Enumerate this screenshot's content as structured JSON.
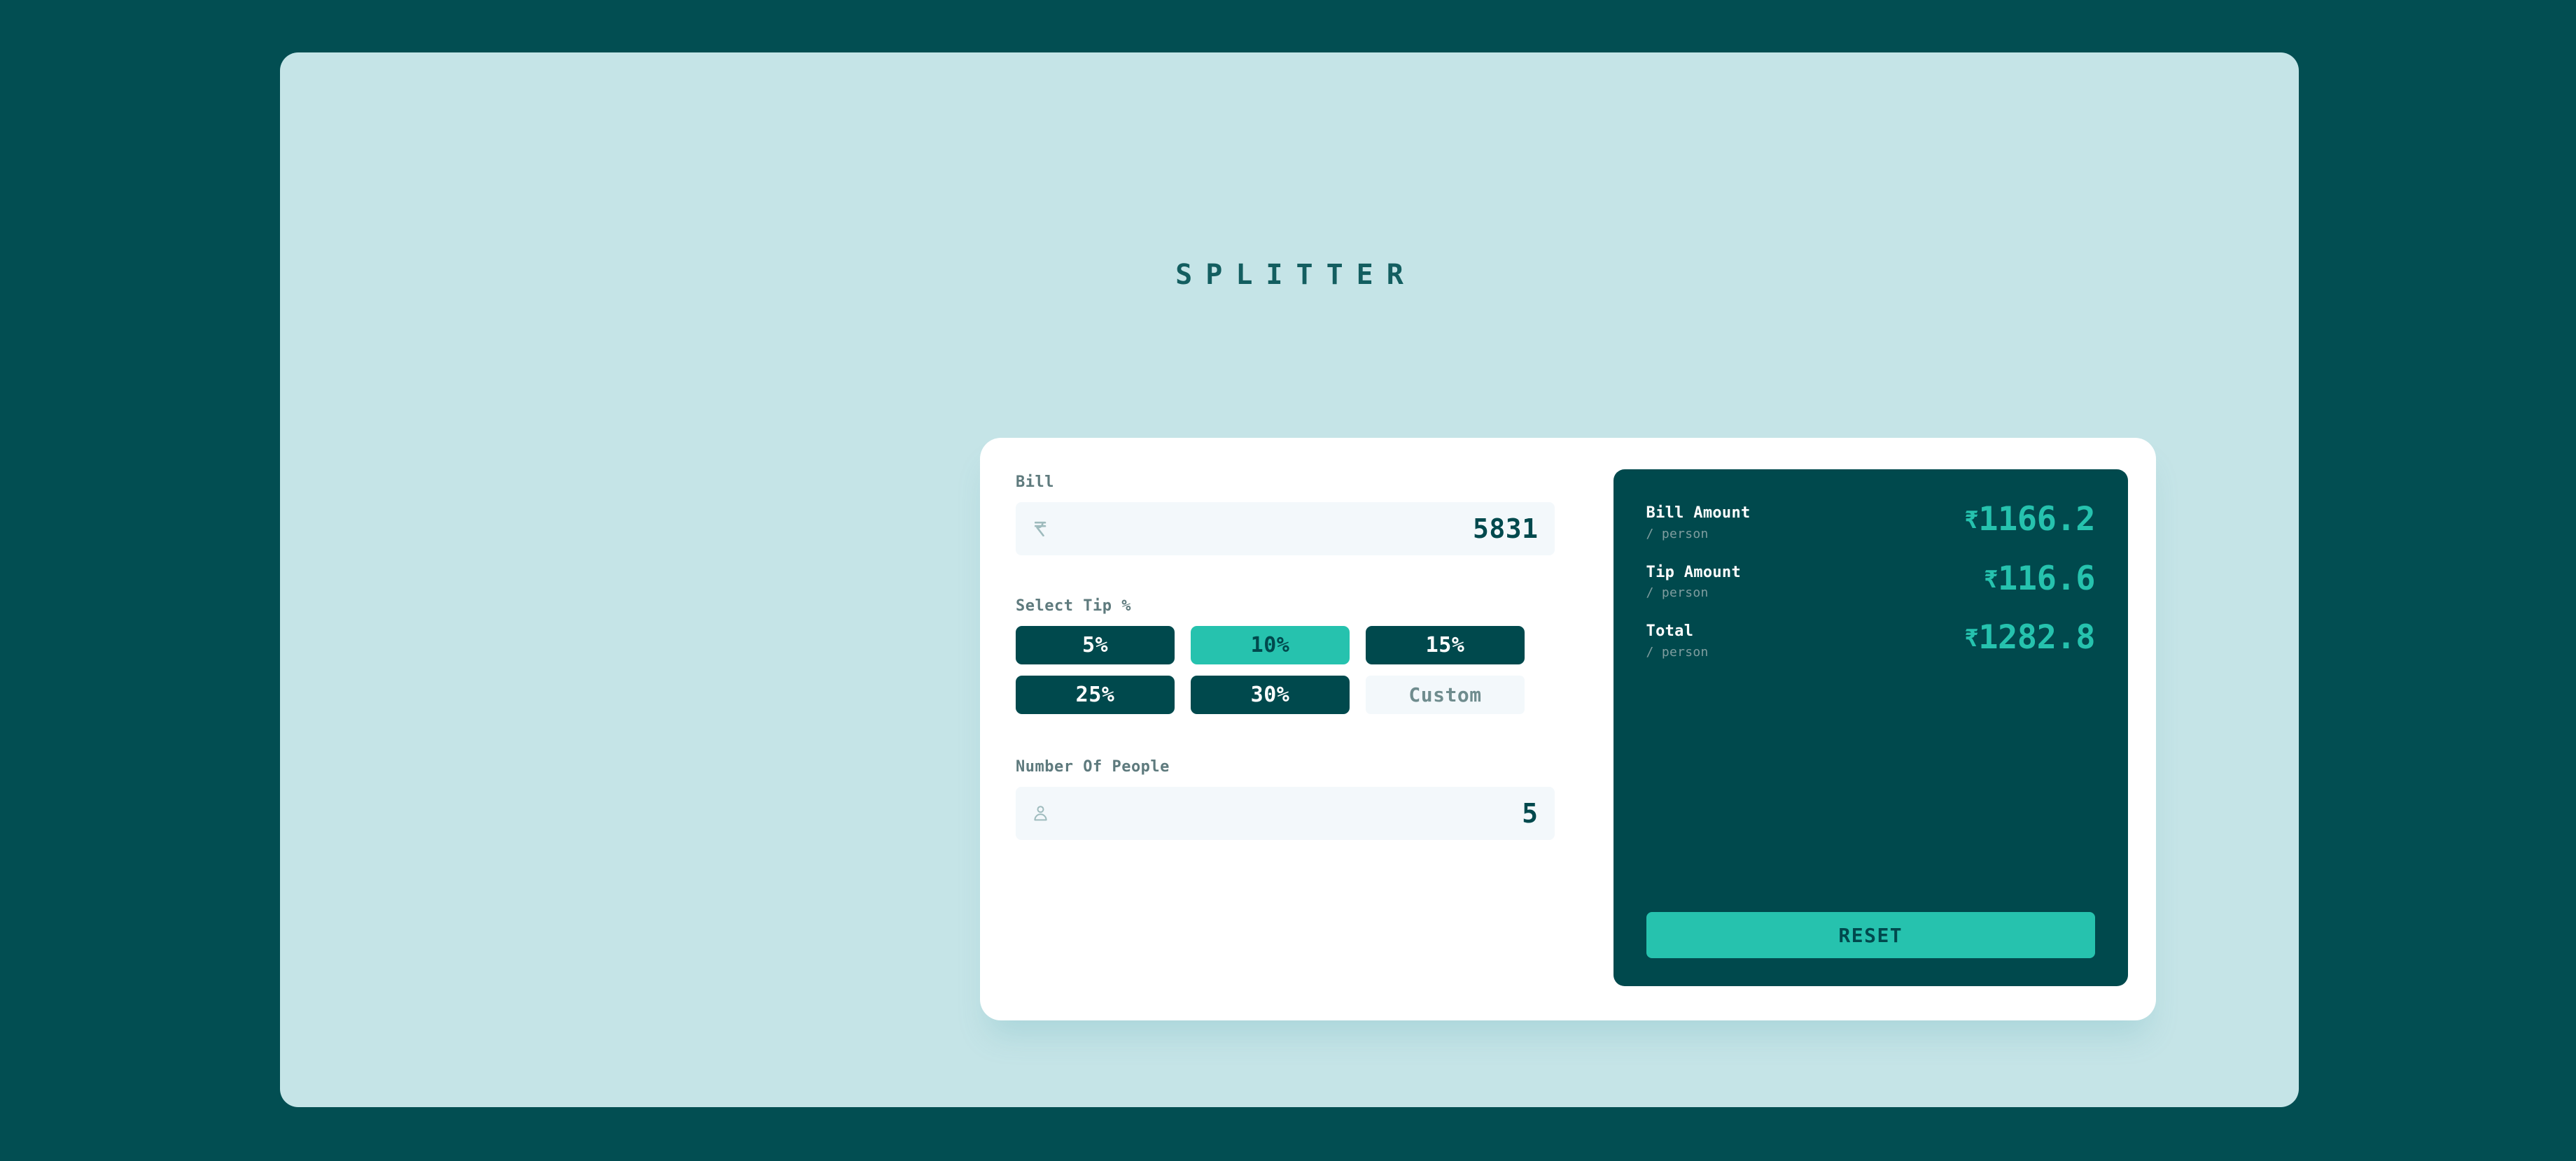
{
  "app": {
    "title": "SPLITTER",
    "background_color": "#024E52",
    "stage_color": "#C5E4E7",
    "accent_color": "#26C2AE",
    "dark_color": "#00494D"
  },
  "bill": {
    "label": "Bill",
    "icon": "rupee-icon",
    "value": "5831"
  },
  "tip": {
    "label": "Select Tip %",
    "options": [
      {
        "label": "5%",
        "active": false
      },
      {
        "label": "10%",
        "active": true
      },
      {
        "label": "15%",
        "active": false
      },
      {
        "label": "25%",
        "active": false
      },
      {
        "label": "30%",
        "active": false
      }
    ],
    "custom": {
      "label": "Custom",
      "placeholder": "Custom"
    }
  },
  "people": {
    "label": "Number Of People",
    "icon": "person-icon",
    "value": "5"
  },
  "results": {
    "rows": [
      {
        "title": "Bill Amount",
        "sub": "/ person",
        "currency": "₹",
        "amount": "1166.2"
      },
      {
        "title": "Tip Amount",
        "sub": "/ person",
        "currency": "₹",
        "amount": "116.6"
      },
      {
        "title": "Total",
        "sub": "/ person",
        "currency": "₹",
        "amount": "1282.8"
      }
    ],
    "reset_label": "RESET"
  }
}
